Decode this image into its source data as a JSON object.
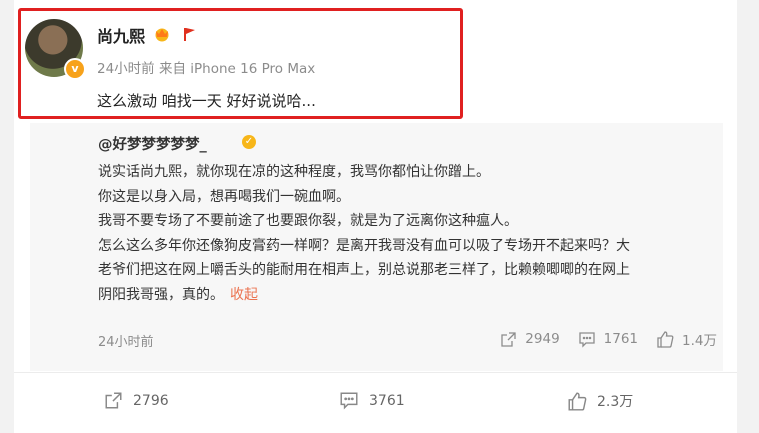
{
  "post": {
    "author": "尚九熙",
    "time": "24小时前",
    "source": "来自 iPhone 16 Pro Max",
    "text": "这么激动 咱找一天 好好说说哈..."
  },
  "repost": {
    "author": "@好梦梦梦梦梦_",
    "lines": [
      "说实话尚九熙，就你现在凉的这种程度，我骂你都怕让你蹭上。",
      "你这是以身入局，想再喝我们一碗血啊。",
      "我哥不要专场了不要前途了也要跟你裂，就是为了远离你这种瘟人。",
      "怎么这么多年你还像狗皮膏药一样啊？是离开我哥没有血可以吸了专场开不起来吗？大",
      "老爷们把这在网上嚼舌头的能耐用在相声上，别总说那老三样了，比赖赖唧唧的在网上"
    ],
    "last_line": "阴阳我哥强，真的。",
    "collapse_label": "收起",
    "time": "24小时前",
    "repost_count": "2949",
    "comment_count": "1761",
    "like_count": "1.4万"
  },
  "bottom": {
    "repost_count": "2796",
    "comment_count": "3761",
    "like_count": "2.3万"
  },
  "colors": {
    "highlight_border": "#e02020",
    "link_orange": "#eb7350",
    "verified_badge": "#f7a21b"
  }
}
